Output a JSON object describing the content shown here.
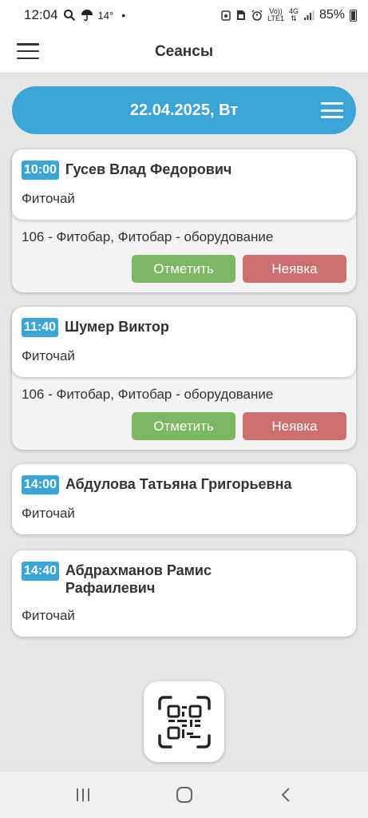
{
  "status_bar": {
    "time": "12:04",
    "temperature": "14°",
    "dot": "•",
    "net_top": "Vo))",
    "net_bottom": "LTE1",
    "net_type": "4G",
    "battery": "85%"
  },
  "app_bar": {
    "title": "Сеансы",
    "menu_icon": "hamburger-icon"
  },
  "date_bar": {
    "date": "22.04.2025, Вт",
    "menu_icon": "hamburger-icon",
    "color": "#3aa5d6"
  },
  "sessions": [
    {
      "time": "10:00",
      "client": "Гусев Влад Федорович",
      "service": "Фиточай",
      "resource": "106 - Фитобар, Фитобар - оборудование",
      "mark_label": "Отметить",
      "noshow_label": "Неявка"
    },
    {
      "time": "11:40",
      "client": "Шумер Виктор",
      "service": "Фиточай",
      "resource": "106 - Фитобар, Фитобар - оборудование",
      "mark_label": "Отметить",
      "noshow_label": "Неявка"
    },
    {
      "time": "14:00",
      "client": "Абдулова Татьяна Григорьевна",
      "service": "Фиточай"
    },
    {
      "time": "14:40",
      "client": "Абдрахманов Рамис Рафаилевич",
      "service": "Фиточай"
    }
  ],
  "qr_button": {
    "icon": "qr-scan-icon"
  },
  "nav_bar": {
    "recent_icon": "recent-apps-icon",
    "home_icon": "home-icon",
    "back_icon": "back-icon"
  },
  "colors": {
    "accent": "#3aa5d6",
    "mark": "#7cb862",
    "noshow": "#cd6f6f"
  }
}
